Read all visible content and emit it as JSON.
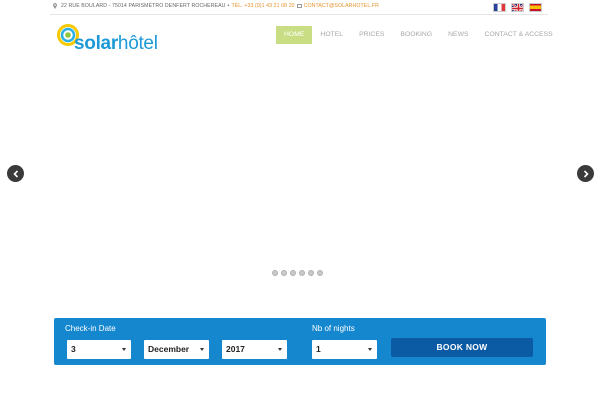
{
  "topbar": {
    "address": "22 RUE BOULARD - 75014 PARIS",
    "metro": "MÉTRO DENFERT ROCHEREAU",
    "phone": "TÉL. +33 (0)1 43 21 08 20",
    "email": "CONTACT@SOLARHOTEL.FR"
  },
  "flags": [
    {
      "name": "french-flag"
    },
    {
      "name": "english-flag"
    },
    {
      "name": "spanish-flag"
    }
  ],
  "logo": {
    "solar": "solar",
    "hotel": "hôtel"
  },
  "nav": {
    "items": [
      {
        "label": "HOME",
        "active": true
      },
      {
        "label": "HOTEL"
      },
      {
        "label": "PRICES"
      },
      {
        "label": "BOOKING"
      },
      {
        "label": "NEWS"
      },
      {
        "label": "CONTACT & ACCESS"
      }
    ]
  },
  "slider": {
    "dot_count": 6
  },
  "booking": {
    "checkin_label": "Check-in Date",
    "day": "3",
    "month": "December",
    "year": "2017",
    "nights_label": "Nb of nights",
    "nights": "1",
    "book_label": "BOOK NOW"
  },
  "colors": {
    "brand_blue": "#1487cf",
    "button_blue": "#0b5aa4",
    "nav_active": "#c9de84",
    "accent_orange": "#e8932c"
  }
}
